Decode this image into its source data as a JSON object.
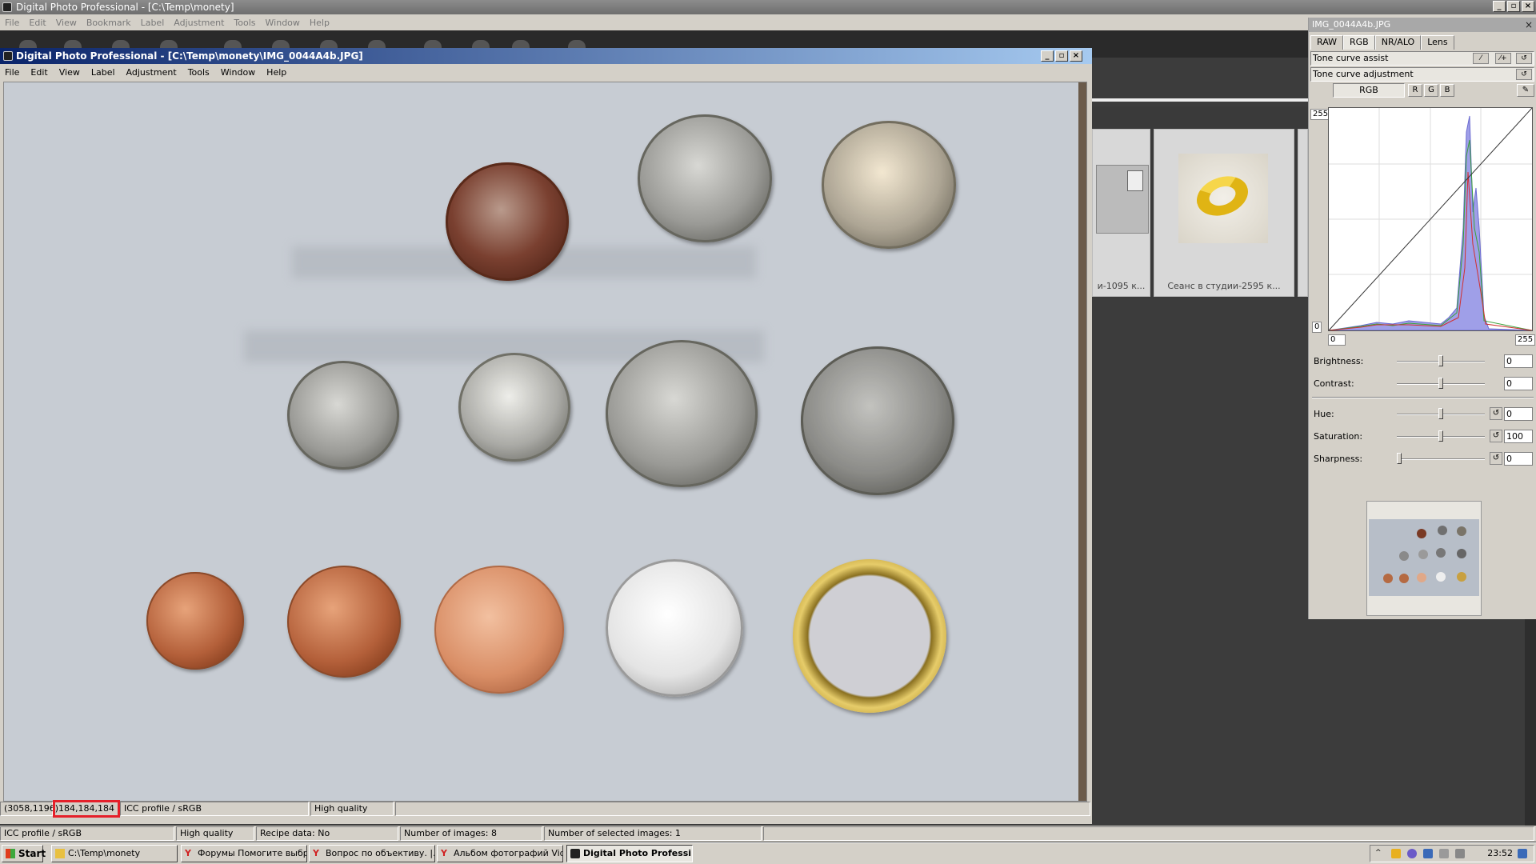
{
  "app": {
    "title": "Digital Photo Professional - [C:\\Temp\\monety]",
    "menu": [
      "File",
      "Edit",
      "View",
      "Bookmark",
      "Label",
      "Adjustment",
      "Tools",
      "Window",
      "Help"
    ]
  },
  "child_window": {
    "title": "Digital Photo Professional - [C:\\Temp\\monety\\IMG_0044A4b.JPG]",
    "menu": [
      "File",
      "Edit",
      "View",
      "Label",
      "Adjustment",
      "Tools",
      "Window",
      "Help"
    ],
    "status": {
      "coords": "(3058,1196)",
      "rgb": "184,184,184",
      "profile": "ICC profile / sRGB",
      "quality": "High quality"
    }
  },
  "thumbnails": [
    {
      "caption": "и-1095 к..."
    },
    {
      "caption": "Сеанс в студии-2595 к..."
    }
  ],
  "palette": {
    "title": "IMG_0044A4b.JPG",
    "tabs": [
      "RAW",
      "RGB",
      "NR/ALO",
      "Lens"
    ],
    "active_tab": "RGB",
    "tone_curve_assist": "Tone curve assist",
    "tone_curve_adjustment": "Tone curve adjustment",
    "channel": "RGB",
    "channels": [
      "R",
      "G",
      "B"
    ],
    "curve_max_label": "255",
    "curve_min_label": "0",
    "input_min": "0",
    "input_max": "255",
    "sliders": [
      {
        "label": "Brightness:",
        "value": "0",
        "level": 0.5
      },
      {
        "label": "Contrast:",
        "value": "0",
        "level": 0.5
      },
      {
        "label": "Hue:",
        "value": "0",
        "level": 0.5
      },
      {
        "label": "Saturation:",
        "value": "100",
        "level": 0.5
      },
      {
        "label": "Sharpness:",
        "value": "0",
        "level": 0.0
      }
    ]
  },
  "outer_status": {
    "profile": "ICC profile / sRGB",
    "quality": "High quality",
    "recipe": "Recipe data: No",
    "images": "Number of images: 8",
    "selected": "Number of selected images: 1"
  },
  "taskbar": {
    "start": "Start",
    "tasks": [
      {
        "label": "C:\\Temp\\monety"
      },
      {
        "label": "Форумы Помогите выбр..."
      },
      {
        "label": "Вопрос по объективу. |..."
      },
      {
        "label": "Альбом фотографий Vid..."
      },
      {
        "label": "Digital Photo Professi..."
      }
    ],
    "clock": "23:52"
  }
}
